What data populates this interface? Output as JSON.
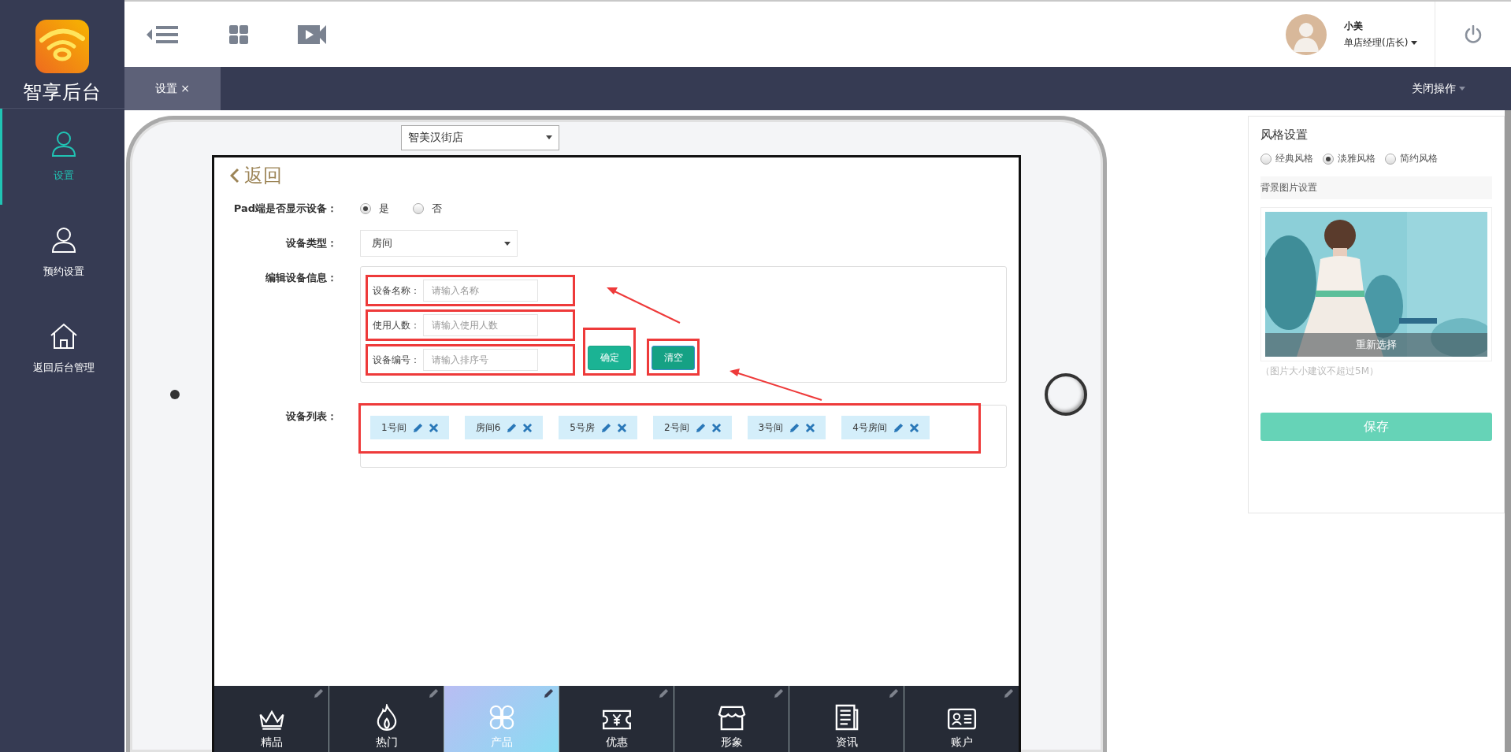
{
  "sidebar": {
    "logo_text": "智享后台",
    "items": [
      {
        "label": "设置",
        "selected": true
      },
      {
        "label": "预约设置",
        "selected": false
      },
      {
        "label": "返回后台管理",
        "selected": false
      }
    ]
  },
  "header": {
    "user": {
      "name": "小美",
      "role": "单店经理(店长)"
    }
  },
  "tabs": [
    {
      "label": "设置",
      "close": "×",
      "selected": true
    }
  ],
  "close_menu": "关闭操作",
  "store_select": {
    "value": "智美汉街店"
  },
  "pad": {
    "back": "返回",
    "show_device": {
      "label": "Pad端是否显示设备：",
      "options": [
        {
          "label": "是",
          "selected": true
        },
        {
          "label": "否",
          "selected": false
        }
      ]
    },
    "device_type": {
      "label": "设备类型：",
      "value": "房间"
    },
    "edit_info": {
      "label": "编辑设备信息：",
      "fields": [
        {
          "label": "设备名称：",
          "placeholder": "请输入名称",
          "highlighted": true
        },
        {
          "label": "使用人数：",
          "placeholder": "请输入使用人数",
          "highlighted": true
        },
        {
          "label": "设备编号：",
          "placeholder": "请输入排序号",
          "highlighted": true
        }
      ],
      "buttons": [
        {
          "label": "确定",
          "highlighted": true
        },
        {
          "label": "清空",
          "highlighted": true
        }
      ]
    },
    "device_list": {
      "label": "设备列表：",
      "highlighted": true,
      "devices": [
        "1号间",
        "房间6",
        "5号房",
        "2号间",
        "3号间",
        "4号房间"
      ]
    },
    "bottom_nav": [
      {
        "label": "精品",
        "selected": false
      },
      {
        "label": "热门",
        "selected": false
      },
      {
        "label": "产品",
        "selected": true
      },
      {
        "label": "优惠",
        "selected": false
      },
      {
        "label": "形象",
        "selected": false
      },
      {
        "label": "资讯",
        "selected": false
      },
      {
        "label": "账户",
        "selected": false
      }
    ]
  },
  "style_panel": {
    "title": "风格设置",
    "options": [
      {
        "label": "经典风格",
        "selected": false
      },
      {
        "label": "淡雅风格",
        "selected": true
      },
      {
        "label": "简约风格",
        "selected": false
      }
    ],
    "background_label": "背景图片设置",
    "reselect": "重新选择",
    "hint": "（图片大小建议不超过5M）",
    "save": "保存"
  }
}
